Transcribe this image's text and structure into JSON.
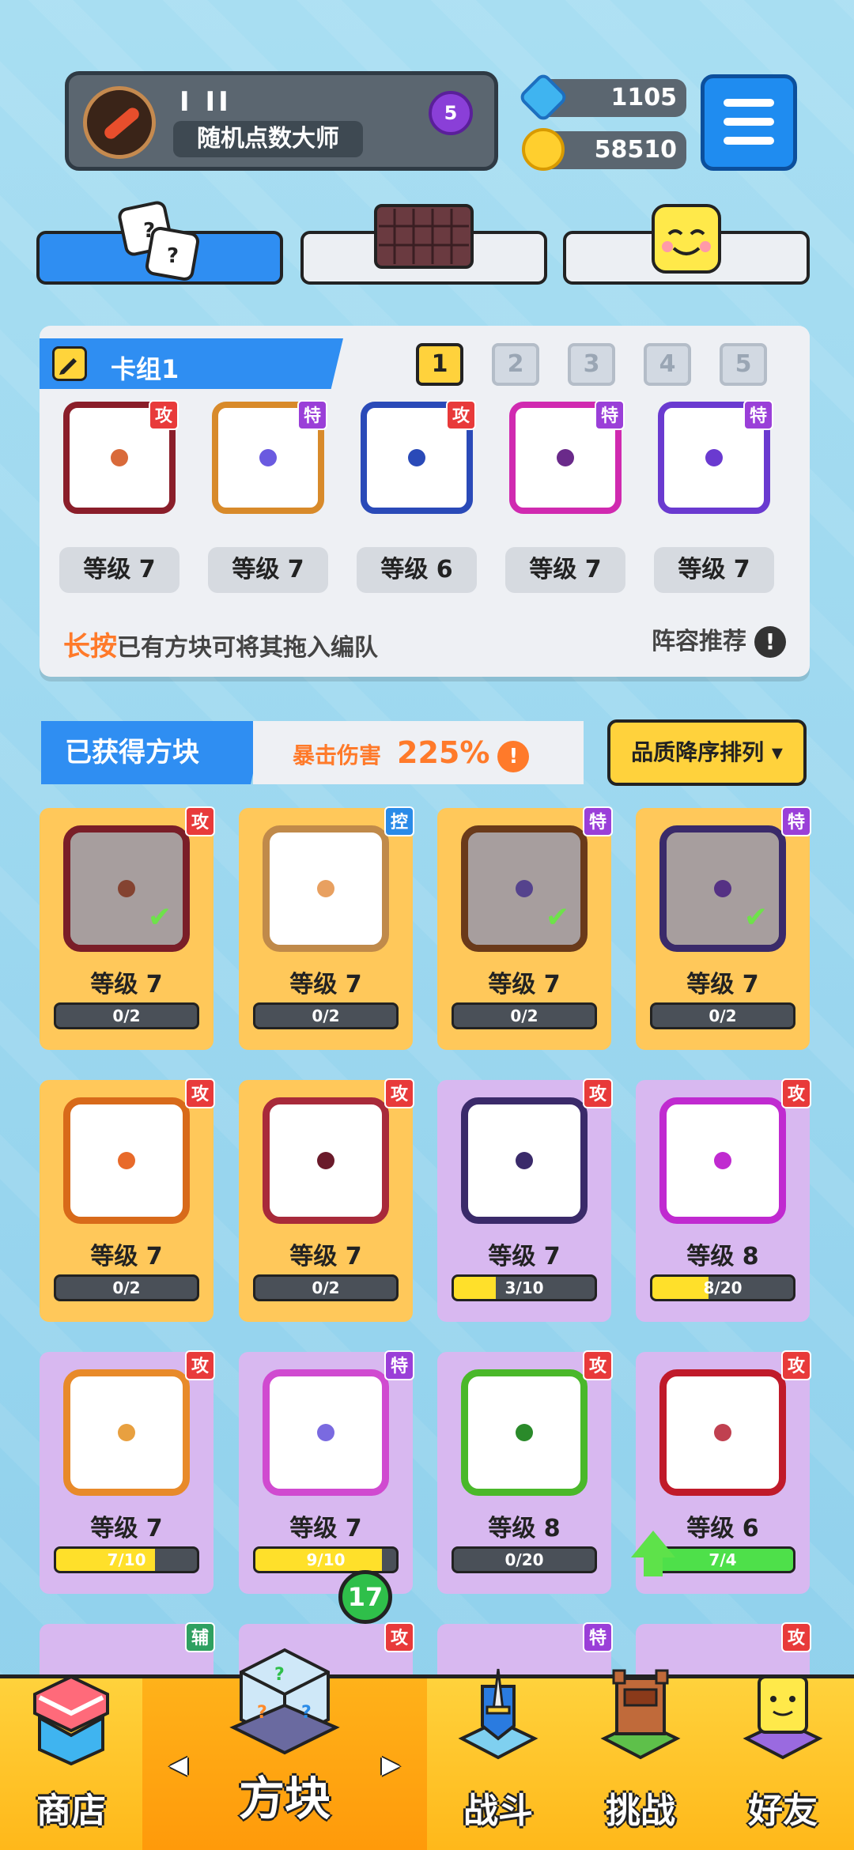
{
  "player": {
    "level_text": "I II",
    "title": "随机点数大师",
    "rank": "5"
  },
  "currency": {
    "gems": "1105",
    "coins": "58510"
  },
  "deck": {
    "title": "卡组1",
    "numbers": [
      "1",
      "2",
      "3",
      "4",
      "5"
    ],
    "active_index": 0,
    "cards": [
      {
        "tag": "攻",
        "tag_type": "atk",
        "level": "等级 7",
        "border": "#8a1e2a",
        "dot": "#d96a3a"
      },
      {
        "tag": "特",
        "tag_type": "spc",
        "level": "等级 7",
        "border": "#d88a2a",
        "dot": "#6a5ae0"
      },
      {
        "tag": "攻",
        "tag_type": "atk",
        "level": "等级 6",
        "border": "#2a4ab8",
        "dot": "#2a4ab8"
      },
      {
        "tag": "特",
        "tag_type": "spc",
        "level": "等级 7",
        "border": "#d02ab0",
        "dot": "#6a2a8a"
      },
      {
        "tag": "特",
        "tag_type": "spc",
        "level": "等级 7",
        "border": "#6a3ad0",
        "dot": "#6a3ad0"
      }
    ],
    "hint_highlight": "长按",
    "hint_rest": "已有方块可将其拖入编队",
    "recommend": "阵容推荐",
    "recommend_icon": "!"
  },
  "obtained": {
    "title": "已获得方块",
    "crit_label": "暴击伤害",
    "crit_value": "225%",
    "crit_icon": "!",
    "sort_label": "品质降序排列 ▾"
  },
  "grid": [
    {
      "rarity": "legend",
      "tag": "攻",
      "tag_type": "atk",
      "level": "等级 7",
      "progress": "0/2",
      "fill": 0,
      "border": "#7a1e28",
      "dot": "#c05a3a",
      "in_deck": true
    },
    {
      "rarity": "legend",
      "tag": "控",
      "tag_type": "ctl",
      "level": "等级 7",
      "progress": "0/2",
      "fill": 0,
      "border": "#c08a4a",
      "dot": "#e8a060",
      "in_deck": false
    },
    {
      "rarity": "legend",
      "tag": "特",
      "tag_type": "spc",
      "level": "等级 7",
      "progress": "0/2",
      "fill": 0,
      "border": "#6a3a1a",
      "dot": "#6a5ae0",
      "in_deck": true
    },
    {
      "rarity": "legend",
      "tag": "特",
      "tag_type": "spc",
      "level": "等级 7",
      "progress": "0/2",
      "fill": 0,
      "border": "#3a2a6a",
      "dot": "#6a3ad0",
      "in_deck": true
    },
    {
      "rarity": "legend",
      "tag": "攻",
      "tag_type": "atk",
      "level": "等级 7",
      "progress": "0/2",
      "fill": 0,
      "border": "#d86a1a",
      "dot": "#e86a2a",
      "in_deck": false
    },
    {
      "rarity": "legend",
      "tag": "攻",
      "tag_type": "atk",
      "level": "等级 7",
      "progress": "0/2",
      "fill": 0,
      "border": "#a82a3a",
      "dot": "#6a1a2a",
      "in_deck": false
    },
    {
      "rarity": "epic",
      "tag": "攻",
      "tag_type": "atk",
      "level": "等级 7",
      "progress": "3/10",
      "fill": 0.3,
      "border": "#3a2a6a",
      "dot": "#3a2a6a",
      "in_deck": false
    },
    {
      "rarity": "epic",
      "tag": "攻",
      "tag_type": "atk",
      "level": "等级 8",
      "progress": "8/20",
      "fill": 0.4,
      "border": "#c02ad0",
      "dot": "#c02ad0",
      "in_deck": false
    },
    {
      "rarity": "epic",
      "tag": "攻",
      "tag_type": "atk",
      "level": "等级 7",
      "progress": "7/10",
      "fill": 0.7,
      "border": "#e88a2a",
      "dot": "#e8a040",
      "in_deck": false
    },
    {
      "rarity": "epic",
      "tag": "特",
      "tag_type": "spc",
      "level": "等级 7",
      "progress": "9/10",
      "fill": 0.9,
      "border": "#d04ad0",
      "dot": "#7a6ae0",
      "in_deck": false
    },
    {
      "rarity": "epic",
      "tag": "攻",
      "tag_type": "atk",
      "level": "等级 8",
      "progress": "0/20",
      "fill": 0,
      "border": "#4ab82a",
      "dot": "#2a8a2a",
      "in_deck": false
    },
    {
      "rarity": "epic",
      "tag": "攻",
      "tag_type": "atk",
      "level": "等级 6",
      "progress": "7/4",
      "fill": 1,
      "border": "#c01a2a",
      "dot": "#c04050",
      "in_deck": false,
      "upgradable": true
    }
  ],
  "partial_row_tags": [
    {
      "tag": "辅",
      "tag_type": "sup"
    },
    {
      "tag": "攻",
      "tag_type": "atk"
    },
    {
      "tag": "特",
      "tag_type": "spc"
    },
    {
      "tag": "攻",
      "tag_type": "atk"
    }
  ],
  "nav": {
    "items": [
      {
        "label": "商店",
        "icon": "shop-icon"
      },
      {
        "label": "方块",
        "icon": "mystery-cube-icon"
      },
      {
        "label": "战斗",
        "icon": "battle-icon"
      },
      {
        "label": "挑战",
        "icon": "challenge-icon"
      },
      {
        "label": "好友",
        "icon": "friends-icon"
      }
    ],
    "active_index": 1,
    "badge": "17",
    "left_arrow": "◀",
    "right_arrow": "▶"
  },
  "colors": {
    "accent_blue": "#2f8ef2",
    "accent_yellow": "#ffd23c",
    "legend_card": "#ffc85a",
    "epic_card": "#d8b8f0"
  }
}
